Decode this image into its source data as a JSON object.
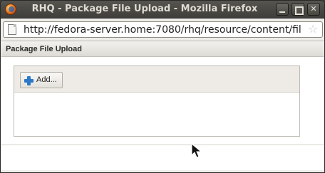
{
  "window": {
    "title": "RHQ - Package File Upload - Mozilla Firefox"
  },
  "browser": {
    "url": "http://fedora-server.home:7080/rhq/resource/content/fil"
  },
  "page": {
    "section_title": "Package File Upload",
    "add_button_label": "Add..."
  },
  "icons": {
    "app": "firefox-icon",
    "page": "document-icon",
    "bookmark": "star-icon",
    "add": "plus-icon",
    "cursor": "mouse-pointer-icon"
  },
  "colors": {
    "titlebar": "#3f3e3a",
    "add_icon": "#2a79c9"
  }
}
